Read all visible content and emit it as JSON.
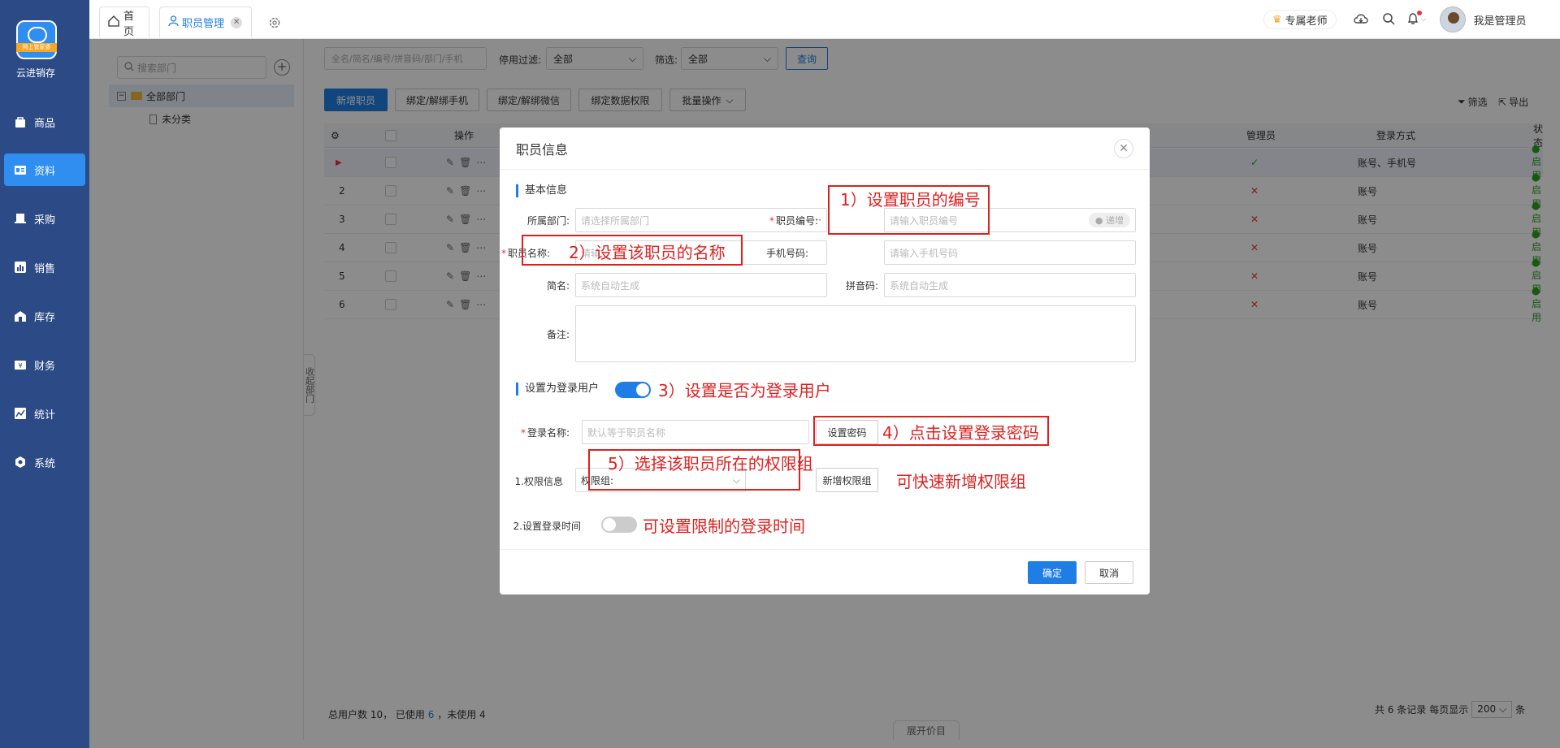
{
  "app": {
    "brand": "云进销存",
    "logo_ribbon": "网上管家婆"
  },
  "nav": [
    {
      "label": "商品",
      "icon": "bag-icon"
    },
    {
      "label": "资料",
      "icon": "profile-card-icon",
      "active": true
    },
    {
      "label": "采购",
      "icon": "purchase-icon"
    },
    {
      "label": "销售",
      "icon": "sales-chart-icon"
    },
    {
      "label": "库存",
      "icon": "warehouse-icon"
    },
    {
      "label": "财务",
      "icon": "finance-icon"
    },
    {
      "label": "统计",
      "icon": "statistics-icon"
    },
    {
      "label": "系统",
      "icon": "system-gear-icon"
    }
  ],
  "tabs": [
    {
      "label": "首页",
      "icon": "home-icon"
    },
    {
      "label": "职员管理",
      "icon": "user-icon",
      "active": true
    }
  ],
  "topright": {
    "teacher": "专属老师",
    "user": "我是管理员"
  },
  "dept": {
    "search_placeholder": "搜索部门",
    "root": "全部部门",
    "child": "未分类"
  },
  "filter": {
    "search_placeholder": "全名/简名/编号/拼音码/部门/手机",
    "stop_label": "停用过滤:",
    "stop_value": "全部",
    "filter_label": "筛选:",
    "filter_value": "全部",
    "query": "查询"
  },
  "toolbar": {
    "add": "新增职员",
    "bind_phone": "绑定/解绑手机",
    "bind_wechat": "绑定/解绑微信",
    "bind_data": "绑定数据权限",
    "batch": "批量操作",
    "filter": "筛选",
    "export": "导出"
  },
  "grid": {
    "headers": {
      "ops": "操作",
      "admin": "管理员",
      "login": "登录方式",
      "status": "状态"
    },
    "rows": [
      {
        "no": "",
        "admin": "✓",
        "admin_ok": true,
        "login": "账号、手机号",
        "status": "● 启用"
      },
      {
        "no": "2",
        "admin": "✕",
        "admin_ok": false,
        "login": "账号",
        "status": "● 启用"
      },
      {
        "no": "3",
        "admin": "✕",
        "admin_ok": false,
        "login": "账号",
        "status": "● 启用"
      },
      {
        "no": "4",
        "admin": "✕",
        "admin_ok": false,
        "login": "账号",
        "status": "● 启用"
      },
      {
        "no": "5",
        "admin": "✕",
        "admin_ok": false,
        "login": "账号",
        "status": "● 启用"
      },
      {
        "no": "6",
        "admin": "✕",
        "admin_ok": false,
        "login": "账号",
        "status": "● 启用"
      }
    ]
  },
  "footer": {
    "total_label": "总用户数 10， 已使用",
    "used": "6",
    "unused": "，未使用 4",
    "records": "共 6 条记录",
    "per_page_label": "每页显示",
    "per_page": "200",
    "unit": "条",
    "expand": "展开价目"
  },
  "side_collapse": "收起部门",
  "modal": {
    "title": "职员信息",
    "basic_section": "基本信息",
    "dept_label": "所属部门:",
    "dept_placeholder": "请选择所属部门",
    "code_label": "职员编号:",
    "code_placeholder": "请输入职员编号",
    "code_increment": "递增",
    "name_label": "职员名称:",
    "name_placeholder": "请输",
    "phone_label": "手机号码:",
    "phone_placeholder": "请输入手机号码",
    "short_label": "简名:",
    "short_placeholder": "系统自动生成",
    "pinyin_label": "拼音码:",
    "pinyin_placeholder": "系统自动生成",
    "remark_label": "备注:",
    "login_section": "设置为登录用户",
    "login_name_label": "登录名称:",
    "login_name_placeholder": "默认等于职员名称",
    "set_password": "设置密码",
    "perm_label": "1.权限信息",
    "perm_group_label": "权限组:",
    "add_perm_group": "新增权限组",
    "login_time_label": "2.设置登录时间",
    "confirm": "确定",
    "cancel": "取消"
  },
  "annotations": {
    "a1": "1）设置职员的编号",
    "a2": "2）设置该职员的名称",
    "a3": "3）设置是否为登录用户",
    "a4": "4）点击设置登录密码",
    "a5": "5）选择该职员所在的权限组",
    "a6": "可快速新增权限组",
    "a7": "可设置限制的登录时间"
  },
  "colors": {
    "sidebar": "#2b4a86",
    "primary": "#1f7ee6",
    "annotation": "#e02020"
  }
}
